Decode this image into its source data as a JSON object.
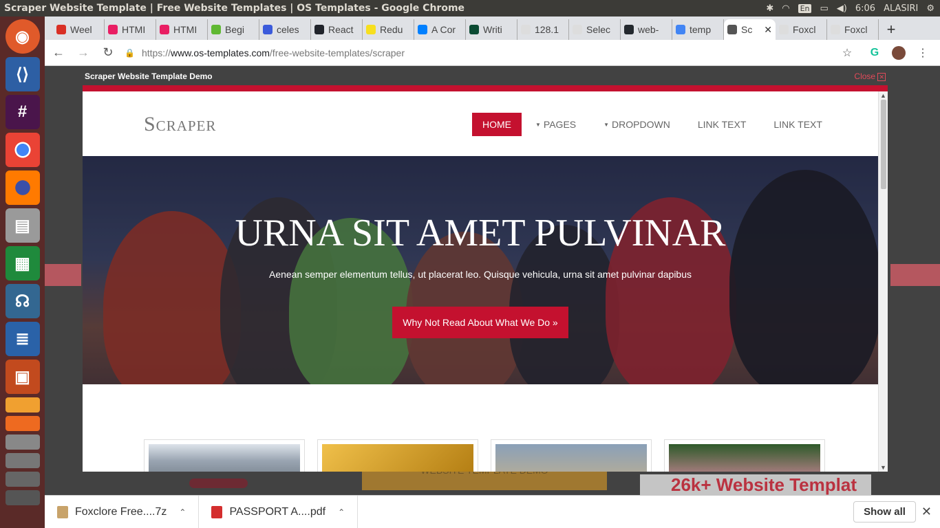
{
  "system": {
    "window_title": "Scraper Website Template | Free Website Templates | OS Templates - Google Chrome",
    "keyboard_lang": "En",
    "clock": "6:06",
    "user": "ALASIRI"
  },
  "tabs": [
    {
      "label": "Weel",
      "color": "#d93025"
    },
    {
      "label": "HTMI",
      "color": "#e91e63"
    },
    {
      "label": "HTMI",
      "color": "#e91e63"
    },
    {
      "label": "Begi",
      "color": "#5fb832"
    },
    {
      "label": "celes",
      "color": "#3b5bdb"
    },
    {
      "label": "React",
      "color": "#20232a"
    },
    {
      "label": "Redu",
      "color": "#f7df1e"
    },
    {
      "label": "A Cor",
      "color": "#0080ff"
    },
    {
      "label": "Writi",
      "color": "#0c4b33"
    },
    {
      "label": "128.1",
      "color": "#dddddd"
    },
    {
      "label": "Selec",
      "color": "#dddddd"
    },
    {
      "label": "web-",
      "color": "#24292e"
    },
    {
      "label": "temp",
      "color": "#4285f4"
    },
    {
      "label": "Sc",
      "color": "#555555",
      "active": true
    },
    {
      "label": "Foxcl",
      "color": "#dddddd"
    },
    {
      "label": "Foxcl",
      "color": "#dddddd"
    }
  ],
  "address": {
    "scheme": "https://",
    "host": "www.os-templates.com",
    "path": "/free-website-templates/scraper"
  },
  "demo": {
    "header_title": "Scraper Website Template Demo",
    "close_label": "Close",
    "behind_button_text": "WEBSITE TEMPLATE DEMO",
    "behind_ad_text": "26k+ Website Templat"
  },
  "site": {
    "logo": "Scraper",
    "nav": [
      {
        "label": "HOME",
        "active": true
      },
      {
        "label": "PAGES",
        "dropdown": true
      },
      {
        "label": "DROPDOWN",
        "dropdown": true
      },
      {
        "label": "LINK TEXT"
      },
      {
        "label": "LINK TEXT"
      }
    ],
    "hero": {
      "title": "URNA SIT AMET PULVINAR",
      "subtitle": "Aenean semper elementum tellus, ut placerat leo. Quisque vehicula, urna sit amet pulvinar dapibus",
      "button": "Why Not Read About What We Do »"
    },
    "cards": [
      {
        "name": "city"
      },
      {
        "name": "brass"
      },
      {
        "name": "boat"
      },
      {
        "name": "flowers"
      }
    ]
  },
  "downloads": {
    "items": [
      {
        "name": "Foxclore Free....7z",
        "color": "#c8a36a"
      },
      {
        "name": "PASSPORT A....pdf",
        "color": "#d42e2e"
      }
    ],
    "show_all": "Show all"
  },
  "colors": {
    "accent": "#c4112f",
    "launcher_bg": "#5a2a28",
    "panel_bg": "#3c3b37"
  }
}
